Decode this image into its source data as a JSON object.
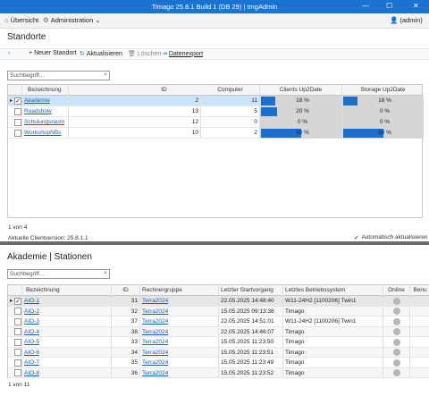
{
  "window": {
    "title": "Timago 25.8.1 Build 1 (DB 29) | tmgAdmin"
  },
  "menu": {
    "overview": "Übersicht",
    "administration": "Administration",
    "user": "(admin)"
  },
  "top": {
    "title": "Standorte",
    "toolbar": {
      "new": "Neuer Standort",
      "refresh": "Aktualisieren",
      "delete": "Löschen",
      "export": "Datenexport"
    },
    "search_placeholder": "Suchbegriff...",
    "columns": [
      "Bezeichnung",
      "ID",
      "Computer",
      "Clients Up2Date",
      "Storage Up2Date"
    ],
    "rows": [
      {
        "name": "Akademie",
        "id": "2",
        "computer": "11",
        "clients_pct": 18,
        "clients": "18 %",
        "storage_pct": 18,
        "storage": "18 %",
        "selected": true
      },
      {
        "name": "Roadshow",
        "id": "13",
        "computer": "5",
        "clients_pct": 20,
        "clients": "20 %",
        "storage_pct": 0,
        "storage": "0 %"
      },
      {
        "name": "Schulungsraum",
        "id": "12",
        "computer": "0",
        "clients_pct": 0,
        "clients": "0 %",
        "storage_pct": 0,
        "storage": "0 %"
      },
      {
        "name": "WorkshopNBs",
        "id": "10",
        "computer": "2",
        "clients_pct": 50,
        "clients": "50 %",
        "storage_pct": 50,
        "storage": "50 %"
      }
    ],
    "count": "1 von 4",
    "version": "Aktuelle Clientversion: 25.8.1.1",
    "auto": "Automatisch aktualisieren"
  },
  "bottom": {
    "title": "Akademie | Stationen",
    "search_placeholder": "Suchbegriff...",
    "columns": [
      "Bezeichnung",
      "ID",
      "Rechnergruppe",
      "Letzter Startvorgang",
      "Letztes Betriebssystem",
      "Online",
      "Benu"
    ],
    "rows": [
      {
        "name": "AIO-1",
        "id": "31",
        "group": "Terra2024",
        "start": "22.05.2025 14:48:40",
        "os": "W11-24H2 [1100206] Twin1",
        "checked": true
      },
      {
        "name": "AIO-2",
        "id": "32",
        "group": "Terra2024",
        "start": "15.05.2025 09:13:38",
        "os": "Timago"
      },
      {
        "name": "AIO-3",
        "id": "37",
        "group": "Terra2024",
        "start": "22.05.2025 14:51:01",
        "os": "W11-24H2 [1100206] Twin1"
      },
      {
        "name": "AIO-4",
        "id": "38",
        "group": "Terra2024",
        "start": "22.05.2025 14:46:07",
        "os": "Timago"
      },
      {
        "name": "AIO-5",
        "id": "33",
        "group": "Terra2024",
        "start": "15.05.2025 11:23:50",
        "os": "Timago"
      },
      {
        "name": "AIO-6",
        "id": "34",
        "group": "Terra2024",
        "start": "15.05.2025 11:23:51",
        "os": "Timago"
      },
      {
        "name": "AIO-7",
        "id": "35",
        "group": "Terra2024",
        "start": "15.05.2025 11:23:49",
        "os": "Timago"
      },
      {
        "name": "AIO-8",
        "id": "36",
        "group": "Terra2024",
        "start": "15.05.2025 11:23:52",
        "os": "Timago"
      }
    ],
    "count": "1 von 11"
  }
}
